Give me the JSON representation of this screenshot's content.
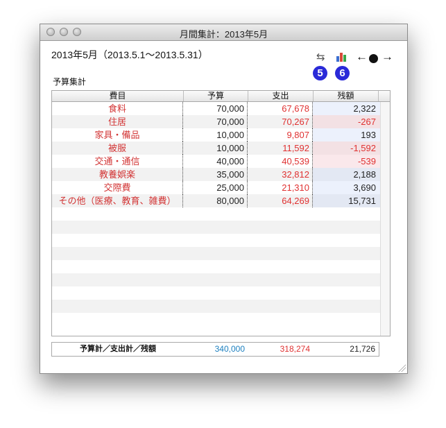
{
  "window": {
    "title": "月間集計：2013年5月"
  },
  "header": {
    "period": "2013年5月（2013.5.1〜2013.5.31）",
    "badges": [
      "5",
      "6"
    ],
    "icons": {
      "swap": "swap-arrows-icon",
      "chart": "bar-chart-icon",
      "prev": "arrow-left-icon",
      "current": "dot-icon",
      "next": "arrow-right-icon"
    }
  },
  "section": {
    "label": "予算集計"
  },
  "table": {
    "columns": [
      "費目",
      "予算",
      "支出",
      "残額"
    ],
    "rows": [
      {
        "name": "食料",
        "budget": "70,000",
        "spent": "67,678",
        "remaining": "2,322",
        "negative": false
      },
      {
        "name": "住居",
        "budget": "70,000",
        "spent": "70,267",
        "remaining": "-267",
        "negative": true
      },
      {
        "name": "家具・備品",
        "budget": "10,000",
        "spent": "9,807",
        "remaining": "193",
        "negative": false
      },
      {
        "name": "被服",
        "budget": "10,000",
        "spent": "11,592",
        "remaining": "-1,592",
        "negative": true
      },
      {
        "name": "交通・通信",
        "budget": "40,000",
        "spent": "40,539",
        "remaining": "-539",
        "negative": true
      },
      {
        "name": "教養娯楽",
        "budget": "35,000",
        "spent": "32,812",
        "remaining": "2,188",
        "negative": false
      },
      {
        "name": "交際費",
        "budget": "25,000",
        "spent": "21,310",
        "remaining": "3,690",
        "negative": false
      },
      {
        "name": "その他（医療、教育、雑費）",
        "budget": "80,000",
        "spent": "64,269",
        "remaining": "15,731",
        "negative": false
      }
    ]
  },
  "totals": {
    "label": "予算計／支出計／残額",
    "budget": "340,000",
    "spent": "318,274",
    "remaining": "21,726"
  },
  "colors": {
    "name_red": "#d23434",
    "spent_red": "#e03131",
    "total_budget_blue": "#1b7fbf",
    "badge_blue": "#2a2ad8"
  }
}
